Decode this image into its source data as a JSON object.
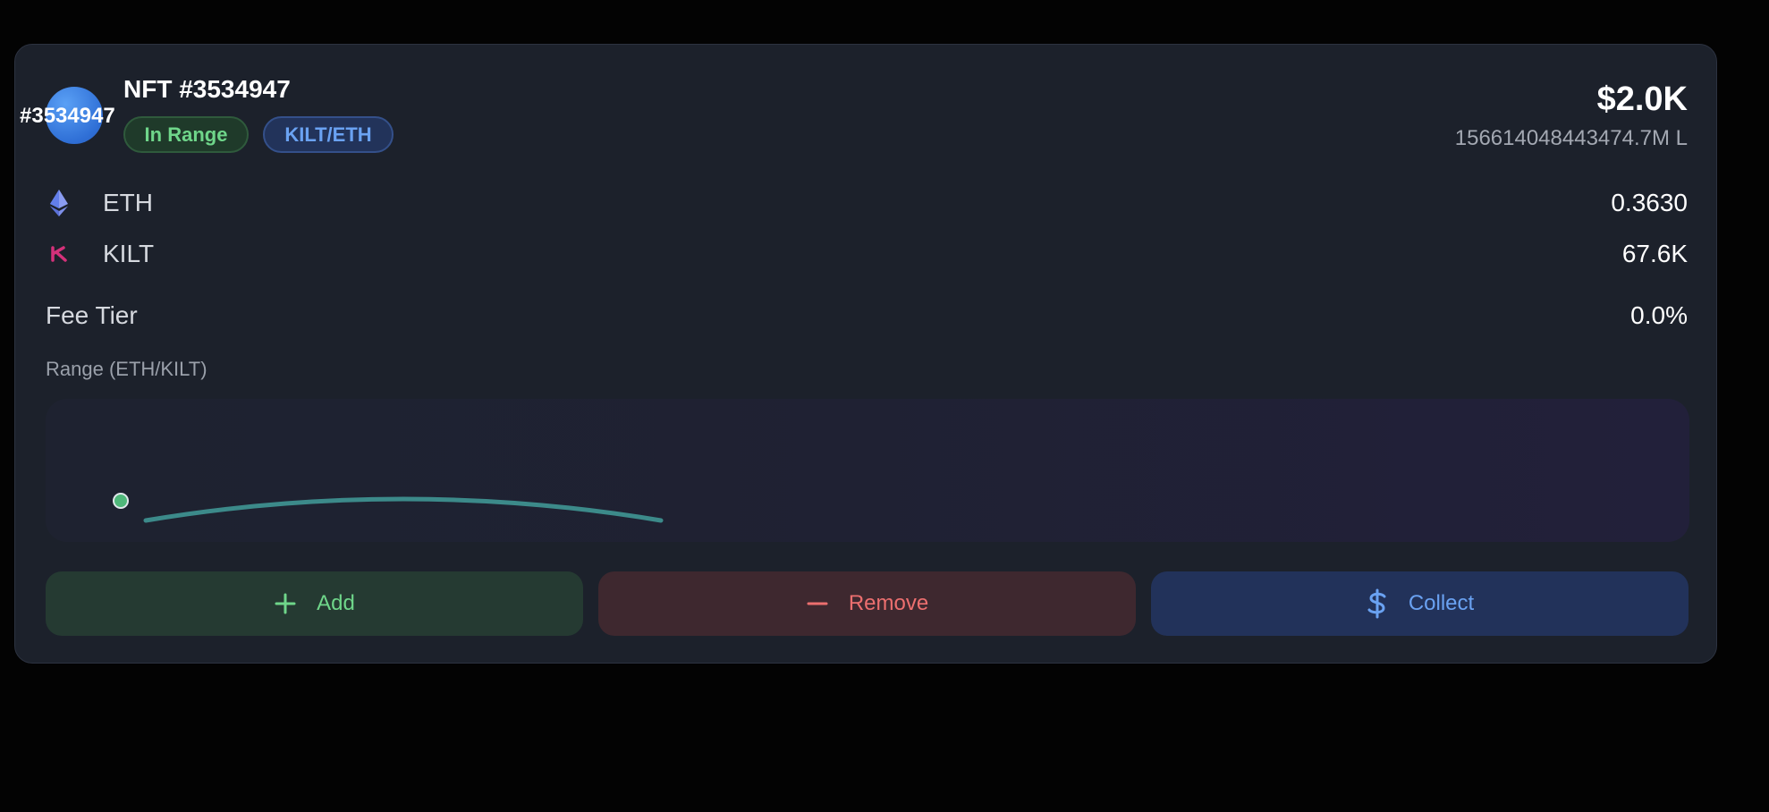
{
  "position": {
    "avatar_label": "#3534947",
    "title": "NFT #3534947",
    "status_badge": "In Range",
    "pair_badge": "KILT/ETH",
    "value_usd": "$2.0K",
    "liquidity": "156614048443474.7M L"
  },
  "tokens": [
    {
      "icon": "ethereum-icon",
      "name": "ETH",
      "amount": "0.3630",
      "color": "#627eea"
    },
    {
      "icon": "kilt-icon",
      "name": "KILT",
      "amount": "67.6K",
      "color": "#d4317a"
    }
  ],
  "fee": {
    "label": "Fee Tier",
    "value": "0.0%"
  },
  "range": {
    "label": "Range (ETH/KILT)"
  },
  "actions": {
    "add_label": "Add",
    "remove_label": "Remove",
    "collect_label": "Collect"
  },
  "colors": {
    "in_range": "#6fd68a",
    "pair": "#6aa2f2",
    "remove": "#ec6f6f",
    "curve": "#3c8a8a"
  }
}
